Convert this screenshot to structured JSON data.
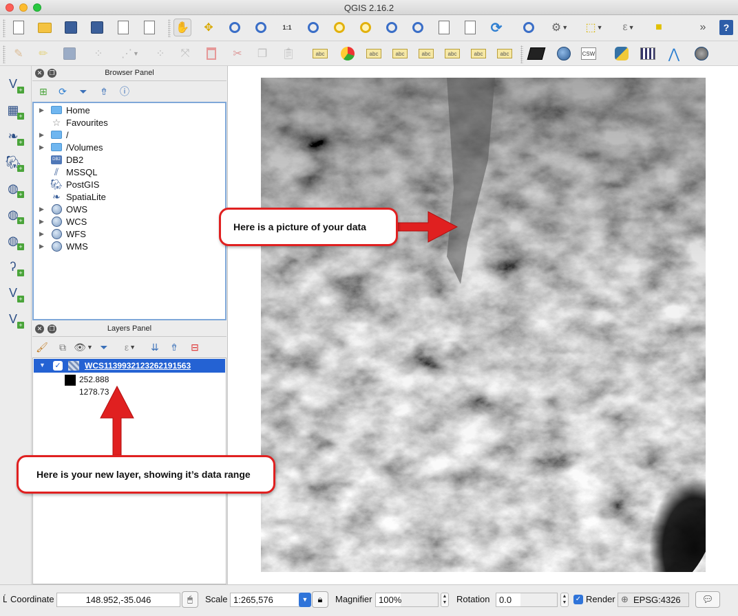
{
  "window": {
    "title": "QGIS 2.16.2"
  },
  "browser_panel": {
    "title": "Browser Panel",
    "items": [
      {
        "label": "Home",
        "icon": "folder-icon",
        "expandable": true
      },
      {
        "label": "Favourites",
        "icon": "star-icon",
        "expandable": false
      },
      {
        "label": "/",
        "icon": "folder-icon",
        "expandable": true
      },
      {
        "label": "/Volumes",
        "icon": "folder-icon",
        "expandable": true
      },
      {
        "label": "DB2",
        "icon": "db2-icon",
        "icon_text": "DB2",
        "expandable": false
      },
      {
        "label": "MSSQL",
        "icon": "mssql-icon",
        "expandable": false
      },
      {
        "label": "PostGIS",
        "icon": "postgis-elephant-icon",
        "expandable": false
      },
      {
        "label": "SpatiaLite",
        "icon": "spatialite-feather-icon",
        "expandable": false
      },
      {
        "label": "OWS",
        "icon": "globe-icon",
        "expandable": true
      },
      {
        "label": "WCS",
        "icon": "globe-icon",
        "expandable": true
      },
      {
        "label": "WFS",
        "icon": "globe-icon",
        "expandable": true
      },
      {
        "label": "WMS",
        "icon": "globe-icon",
        "expandable": true
      }
    ]
  },
  "layers_panel": {
    "title": "Layers Panel",
    "layer": {
      "name": "WCS1139932123262191563",
      "checked": true,
      "legend_min": "252.888",
      "legend_max": "1278.73"
    }
  },
  "annotations": {
    "map_callout": "Here is a picture of your data",
    "layer_callout": "Here is your new layer, showing it’s data range"
  },
  "statusbar": {
    "coordinate_label": "Coordinate",
    "coordinate_label_prefix": "Ĺ",
    "coordinate_value": "148.952,-35.046",
    "scale_label": "Scale",
    "scale_value": "1:265,576",
    "magnifier_label": "Magnifier",
    "magnifier_value": "100%",
    "rotation_label": "Rotation",
    "rotation_value": "0.0",
    "render_label": "Render",
    "render_checked": true,
    "crs": "EPSG:4326"
  },
  "colors": {
    "accent": "#2462d3",
    "annotation_red": "#e02020",
    "panel_bg": "#ececec"
  },
  "toolbar_glyphs": {
    "overflow": "»",
    "help": "?",
    "zoom_one": "1:1",
    "abc": "abc",
    "csw": "CSW"
  }
}
